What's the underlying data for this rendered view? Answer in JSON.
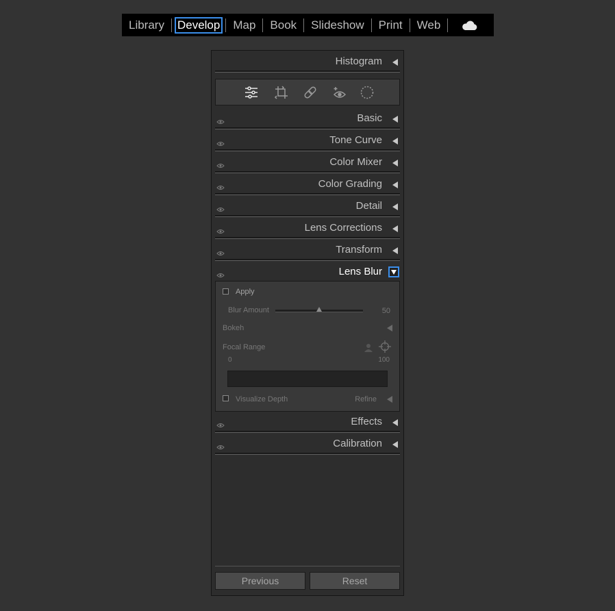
{
  "modules": {
    "items": [
      {
        "label": "Library"
      },
      {
        "label": "Develop",
        "active": true
      },
      {
        "label": "Map"
      },
      {
        "label": "Book"
      },
      {
        "label": "Slideshow"
      },
      {
        "label": "Print"
      },
      {
        "label": "Web"
      }
    ],
    "cloud_icon": "cloud-icon"
  },
  "panel": {
    "histogram": "Histogram",
    "tools": [
      "edit-sliders-icon",
      "crop-icon",
      "healing-icon",
      "red-eye-icon",
      "masking-icon"
    ],
    "sections": {
      "basic": "Basic",
      "tone_curve": "Tone Curve",
      "color_mixer": "Color Mixer",
      "color_grading": "Color Grading",
      "detail": "Detail",
      "lens_corrections": "Lens Corrections",
      "transform": "Transform",
      "lens_blur": "Lens Blur",
      "effects": "Effects",
      "calibration": "Calibration"
    },
    "lens_blur": {
      "apply_label": "Apply",
      "apply_checked": false,
      "blur_amount_label": "Blur Amount",
      "blur_amount_value": "50",
      "blur_amount": 50,
      "bokeh_label": "Bokeh",
      "focal_range_label": "Focal Range",
      "range_min": "0",
      "range_max": "100",
      "visualize_depth_label": "Visualize Depth",
      "visualize_depth_checked": false,
      "refine_label": "Refine"
    },
    "buttons": {
      "previous": "Previous",
      "reset": "Reset"
    }
  },
  "colors": {
    "accent": "#3b8eea",
    "background": "#333333",
    "panel": "#2d2d2d"
  }
}
